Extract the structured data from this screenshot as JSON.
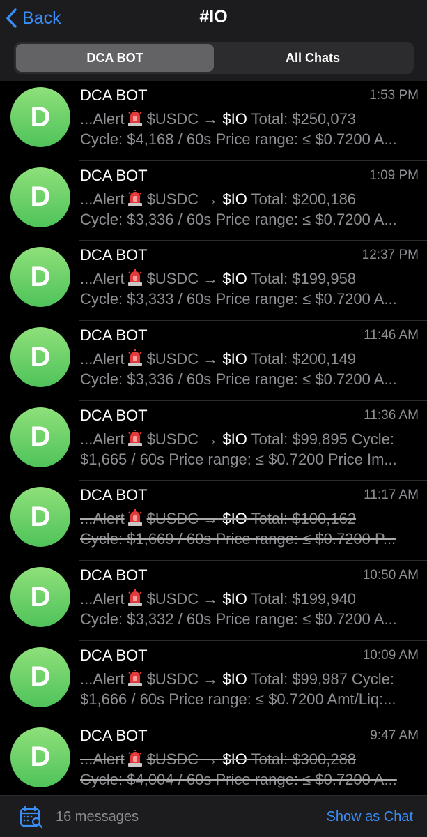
{
  "header": {
    "back_label": "Back",
    "title": "#IO",
    "tabs": [
      {
        "label": "DCA BOT",
        "active": true
      },
      {
        "label": "All Chats",
        "active": false
      }
    ]
  },
  "messages": [
    {
      "name": "DCA BOT",
      "time": "1:53 PM",
      "avatar": "D",
      "struck": false,
      "l1a": "...Alert",
      "l1b": "$USDC →",
      "l1c": "$IO",
      "l1d": "Total: $250,073",
      "line2": "Cycle: $4,168 / 60s Price range: ≤ $0.7200 A..."
    },
    {
      "name": "DCA BOT",
      "time": "1:09 PM",
      "avatar": "D",
      "struck": false,
      "l1a": "...Alert",
      "l1b": "$USDC →",
      "l1c": "$IO",
      "l1d": "Total: $200,186",
      "line2": "Cycle: $3,336 / 60s Price range: ≤ $0.7200 A..."
    },
    {
      "name": "DCA BOT",
      "time": "12:37 PM",
      "avatar": "D",
      "struck": false,
      "l1a": "...Alert",
      "l1b": "$USDC →",
      "l1c": "$IO",
      "l1d": "Total: $199,958",
      "line2": "Cycle: $3,333 / 60s Price range: ≤ $0.7200 A..."
    },
    {
      "name": "DCA BOT",
      "time": "11:46 AM",
      "avatar": "D",
      "struck": false,
      "l1a": "...Alert",
      "l1b": "$USDC →",
      "l1c": "$IO",
      "l1d": "Total: $200,149",
      "line2": "Cycle: $3,336 / 60s Price range: ≤ $0.7200 A..."
    },
    {
      "name": "DCA BOT",
      "time": "11:36 AM",
      "avatar": "D",
      "struck": false,
      "l1a": "...Alert",
      "l1b": "$USDC →",
      "l1c": "$IO",
      "l1d": "Total: $99,895 Cycle:",
      "line2": "$1,665 / 60s Price range: ≤ $0.7200 Price Im..."
    },
    {
      "name": "DCA BOT",
      "time": "11:17 AM",
      "avatar": "D",
      "struck": true,
      "l1a": "...Alert",
      "l1b": "$USDC →",
      "l1c": "$IO",
      "l1d": "Total: $100,162",
      "line2": "Cycle: $1,669 / 60s Price range: ≤ $0.7200 P..."
    },
    {
      "name": "DCA BOT",
      "time": "10:50 AM",
      "avatar": "D",
      "struck": false,
      "l1a": "...Alert",
      "l1b": "$USDC →",
      "l1c": "$IO",
      "l1d": "Total: $199,940",
      "line2": "Cycle: $3,332 / 60s Price range: ≤ $0.7200 A..."
    },
    {
      "name": "DCA BOT",
      "time": "10:09 AM",
      "avatar": "D",
      "struck": false,
      "l1a": "...Alert",
      "l1b": "$USDC →",
      "l1c": "$IO",
      "l1d": "Total: $99,987 Cycle:",
      "line2": "$1,666 / 60s Price range: ≤ $0.7200 Amt/Liq:..."
    },
    {
      "name": "DCA BOT",
      "time": "9:47 AM",
      "avatar": "D",
      "struck": true,
      "l1a": "...Alert",
      "l1b": "$USDC →",
      "l1c": "$IO",
      "l1d": "Total: $300,288",
      "line2": "Cycle: $4,004 / 60s Price range: ≤ $0.7200 A..."
    }
  ],
  "footer": {
    "calendar_icon": "calendar-search-icon",
    "count_label": "16 messages",
    "show_chat_label": "Show as Chat"
  },
  "colors": {
    "accent": "#3a8ef7",
    "avatar": "#5cc85e",
    "secondary_text": "#8e8e93",
    "alarm": "#e23b3b"
  }
}
